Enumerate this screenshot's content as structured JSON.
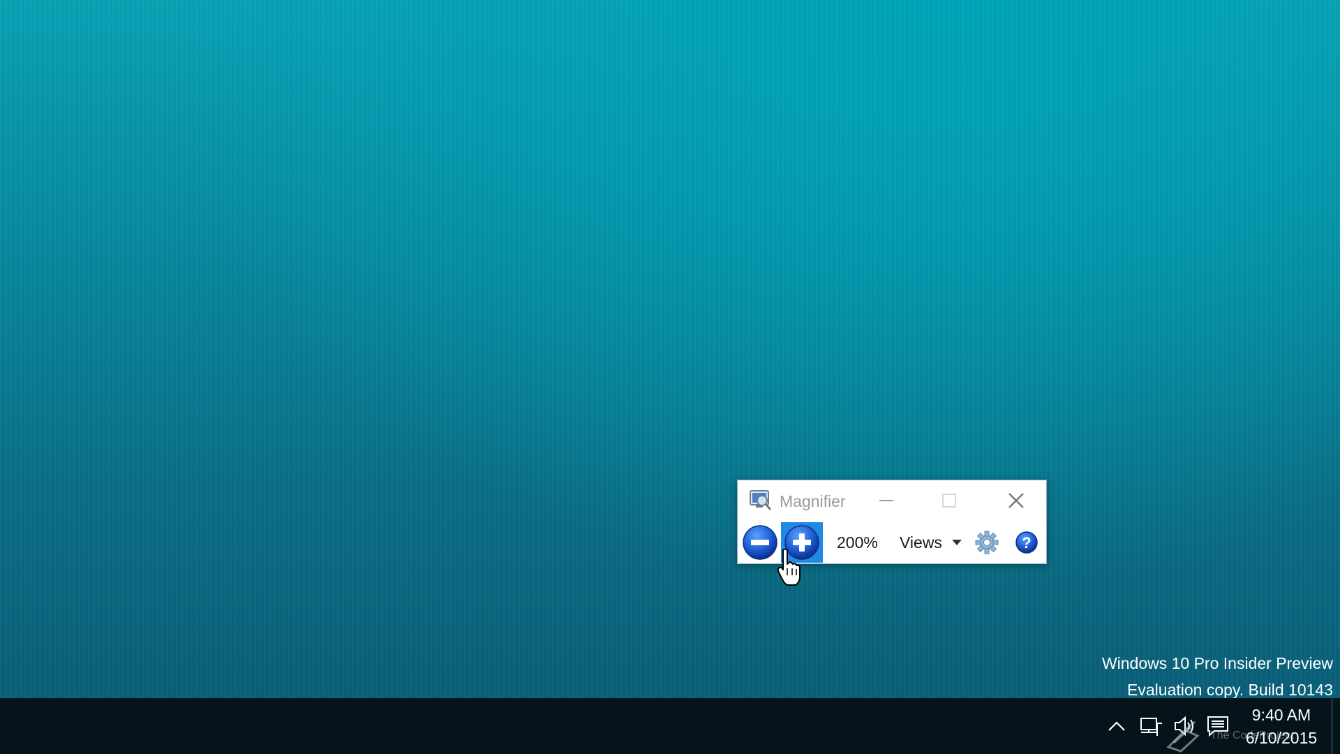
{
  "magnifier": {
    "title": "Magnifier",
    "zoom_level": "200%",
    "views_label": "Views",
    "icons": {
      "app": "magnifier-app-icon",
      "minimize": "minimize-icon",
      "maximize": "maximize-icon",
      "close": "close-icon",
      "zoom_out": "minus-circle-icon",
      "zoom_in": "plus-circle-icon",
      "dropdown": "caret-down-icon",
      "options": "gear-icon",
      "help": "question-mark-icon"
    },
    "colors": {
      "zoom_button_blue": "#1e5fd6",
      "zoom_in_hover": "#1e8ae6",
      "title_gray": "#9a9a9a"
    }
  },
  "watermark": {
    "line1": "Windows 10 Pro Insider Preview",
    "line2": "Evaluation copy. Build 10143"
  },
  "taskbar": {
    "clock_time": "9:40 AM",
    "clock_date": "6/10/2015",
    "tray_icons": [
      "chevron-up-icon",
      "network-icon",
      "volume-icon",
      "action-center-icon"
    ],
    "color": "#04141a"
  },
  "overlay": {
    "text": "The CodeProject"
  },
  "desktop": {
    "background_color": "#0a7f96"
  }
}
